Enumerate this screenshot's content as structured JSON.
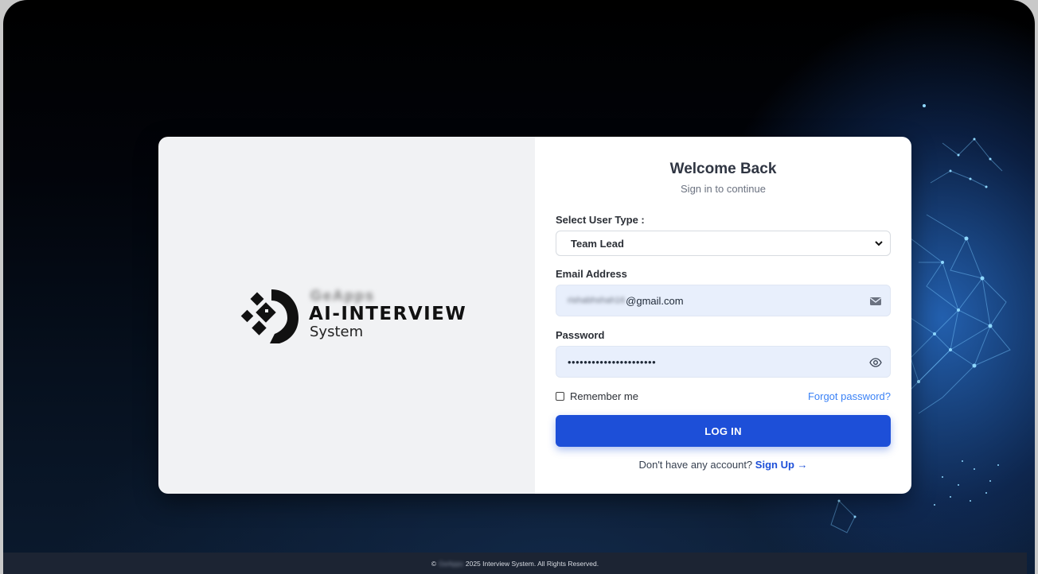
{
  "brand": {
    "blurred_name": "GeApps",
    "main": "AI-INTERVIEW",
    "sub": "System",
    "logo_icon": "robot-head-icon"
  },
  "login": {
    "title": "Welcome Back",
    "subtitle": "Sign in to continue",
    "user_type_label": "Select User Type :",
    "user_type_value": "Team Lead",
    "email_label": "Email Address",
    "email_blurred": "rishabhshah16",
    "email_domain": "@gmail.com",
    "email_icon": "envelope-icon",
    "password_label": "Password",
    "password_masked": "••••••••••••••••••••••",
    "password_icon": "eye-icon",
    "remember_label": "Remember me",
    "forgot_label": "Forgot password?",
    "login_button": "LOG IN",
    "signup_prompt": "Don't have any account?",
    "signup_link": "Sign Up →"
  },
  "footer": {
    "copyright_symbol": "©",
    "blurred_company": "GeApps",
    "text": "2025 Interview System. All Rights Reserved."
  },
  "colors": {
    "primary": "#1d4fd8",
    "link": "#3b82f6",
    "input_bg": "#e8effc",
    "footer_bg": "#1c2433"
  }
}
